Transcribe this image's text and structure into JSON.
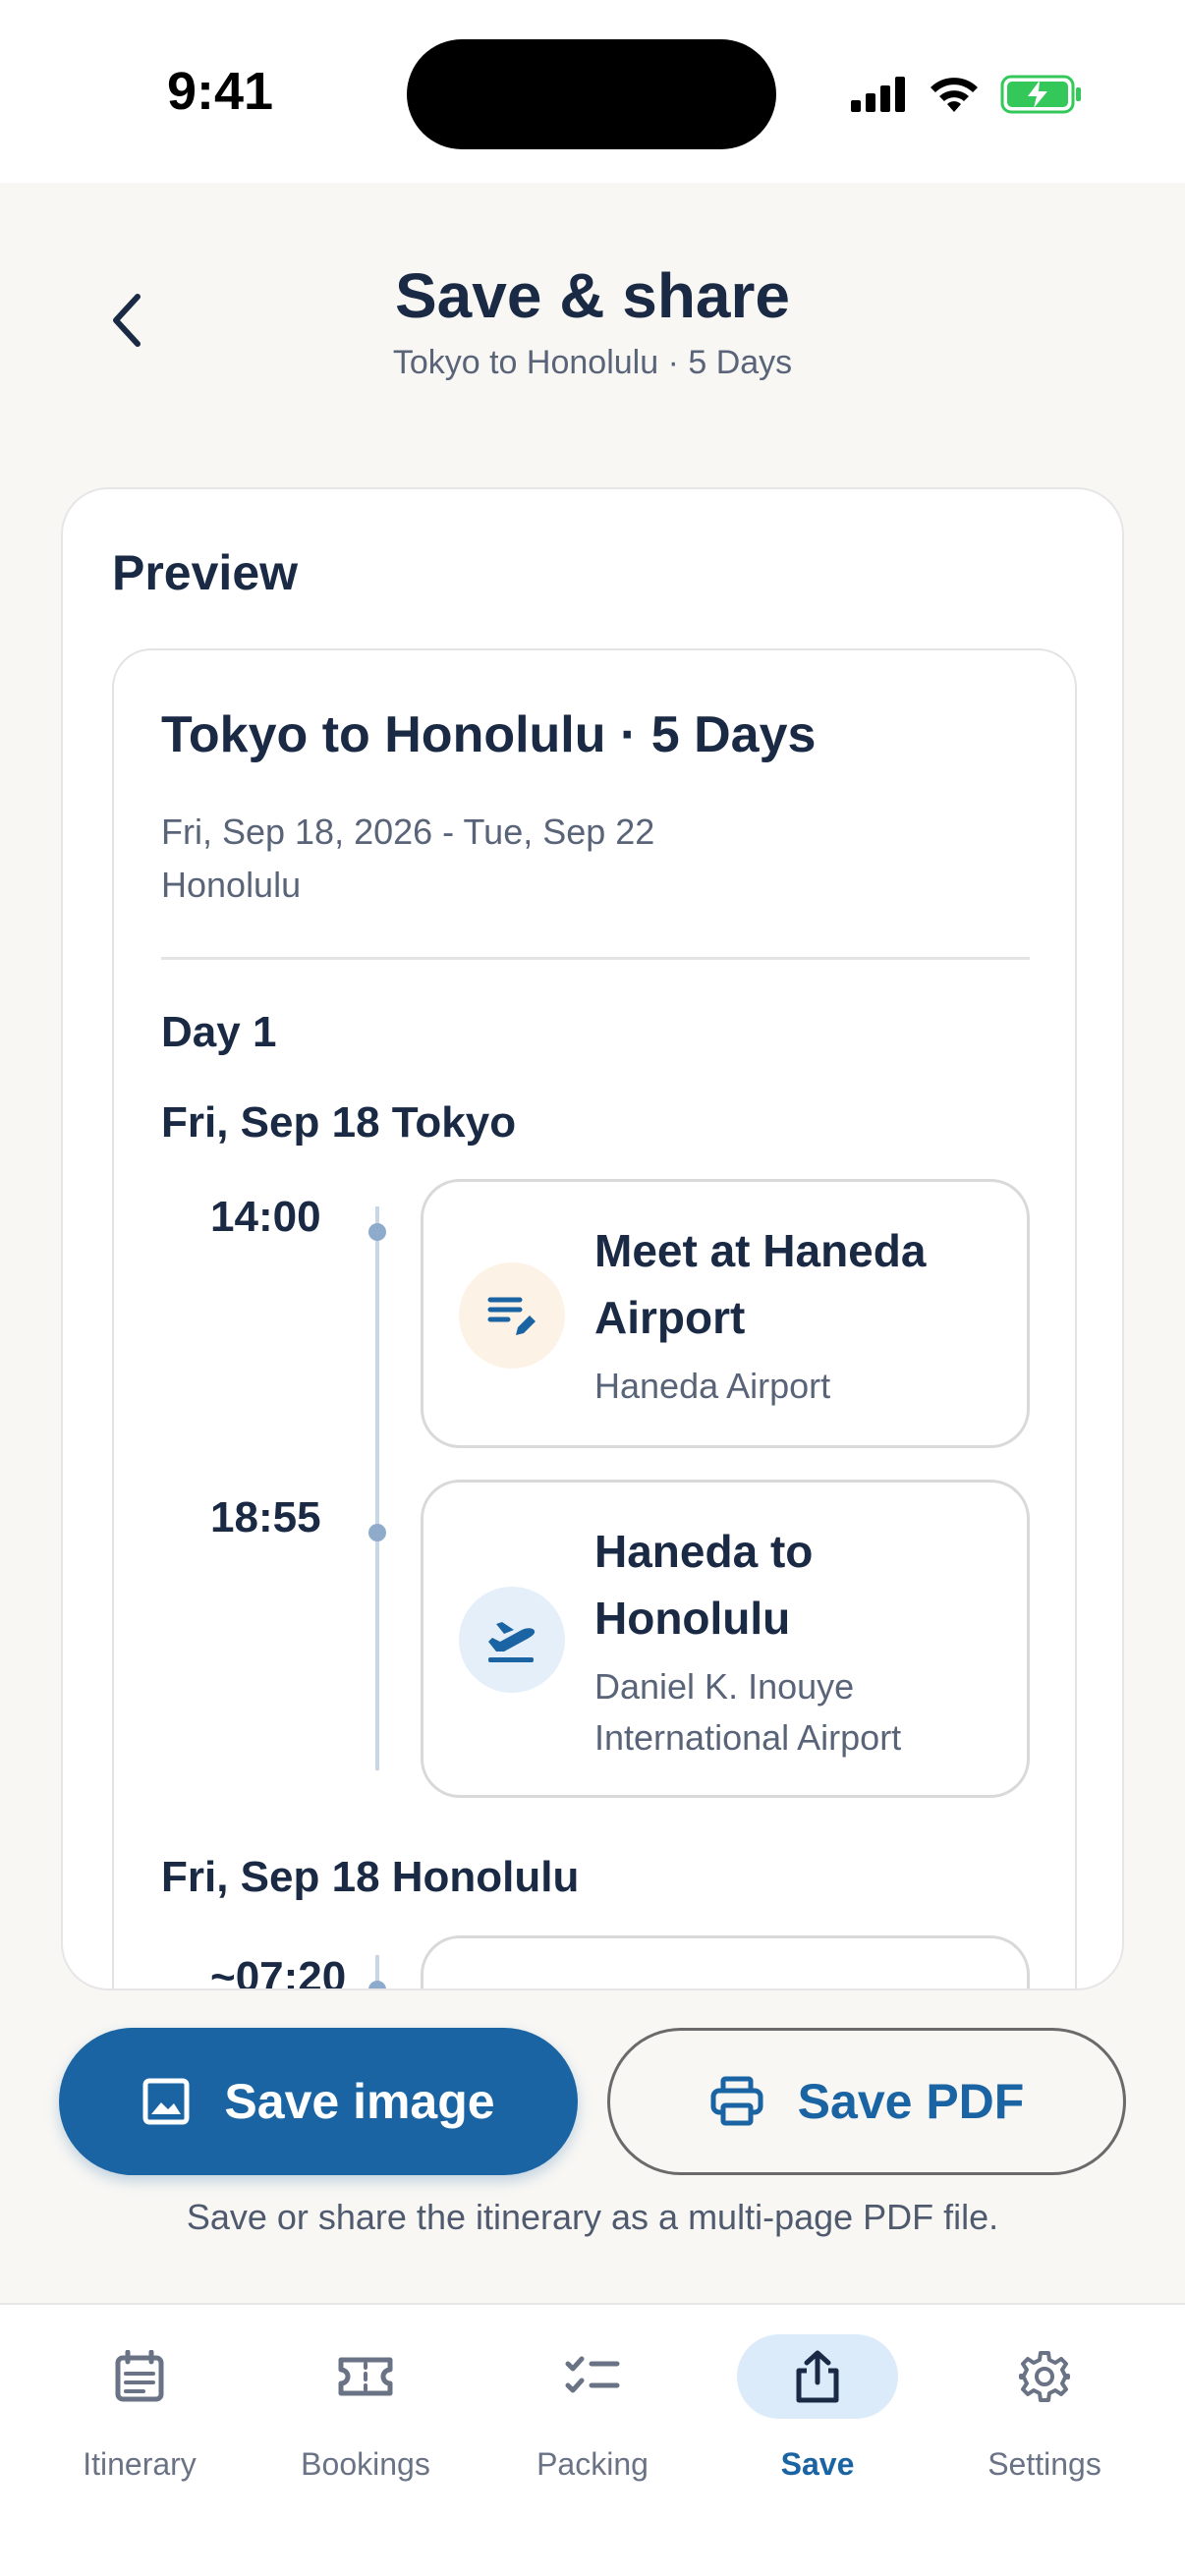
{
  "status": {
    "time": "9:41"
  },
  "header": {
    "title": "Save & share",
    "subtitle": "Tokyo to Honolulu · 5 Days"
  },
  "preview": {
    "label": "Preview",
    "doc": {
      "title": "Tokyo to Honolulu · 5 Days",
      "dates": "Fri, Sep 18, 2026 - Tue, Sep 22",
      "place": "Honolulu",
      "day_label": "Day 1",
      "sections": [
        {
          "heading": "Fri, Sep 18  Tokyo",
          "events": [
            {
              "time": "14:00",
              "title": "Meet at Haneda Airport",
              "subtitle": "Haneda Airport",
              "icon": "note-edit-icon"
            },
            {
              "time": "18:55",
              "title": "Haneda to Honolulu",
              "subtitle": "Daniel K. Inouye International Airport",
              "icon": "plane-departure-icon"
            }
          ]
        },
        {
          "heading": "Fri, Sep 18  Honolulu",
          "events": [
            {
              "time": "~07:20"
            }
          ]
        }
      ]
    }
  },
  "actions": {
    "save_image_label": "Save image",
    "save_pdf_label": "Save PDF",
    "hint": "Save or share the itinerary as a multi-page PDF file."
  },
  "tabs": [
    {
      "label": "Itinerary",
      "icon": "calendar-icon",
      "active": false
    },
    {
      "label": "Bookings",
      "icon": "ticket-icon",
      "active": false
    },
    {
      "label": "Packing",
      "icon": "checklist-icon",
      "active": false
    },
    {
      "label": "Save",
      "icon": "share-icon",
      "active": true
    },
    {
      "label": "Settings",
      "icon": "gear-icon",
      "active": false
    }
  ],
  "colors": {
    "primary": "#1A64A3",
    "background": "#F8F7F4",
    "text": "#1B2A44",
    "muted": "#5A6478"
  }
}
